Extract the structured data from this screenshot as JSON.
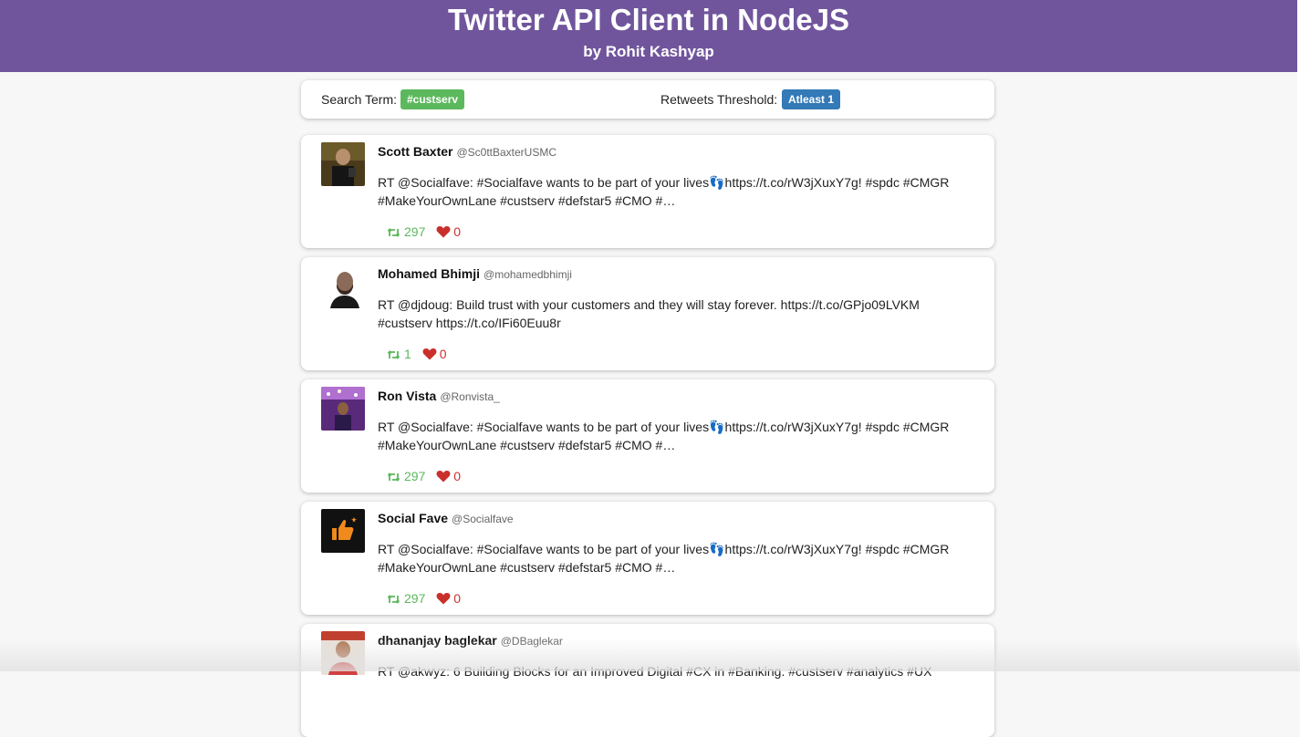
{
  "header": {
    "title": "Twitter API Client in NodeJS",
    "subtitle": "by Rohit Kashyap"
  },
  "filters": {
    "search_label": "Search Term:",
    "search_value": "#custserv",
    "threshold_label": "Retweets Threshold:",
    "threshold_value": "Atleast 1"
  },
  "tweets": [
    {
      "name": "Scott Baxter",
      "handle": "@Sc0ttBaxterUSMC",
      "text": "RT @Socialfave: #Socialfave wants to be part of your lives👣https://t.co/rW3jXuxY7g! #spdc #CMGR #MakeYourOwnLane #custserv #defstar5 #CMO #…",
      "retweets": "297",
      "likes": "0",
      "avatar": "photo-dark"
    },
    {
      "name": "Mohamed Bhimji",
      "handle": "@mohamedbhimji",
      "text": "RT @djdoug: Build trust with your customers and they will stay forever. https://t.co/GPjo09LVKM #custserv https://t.co/IFi60Euu8r",
      "retweets": "1",
      "likes": "0",
      "avatar": "photo-portrait"
    },
    {
      "name": "Ron Vista",
      "handle": "@Ronvista_",
      "text": "RT @Socialfave: #Socialfave wants to be part of your lives👣https://t.co/rW3jXuxY7g! #spdc #CMGR #MakeYourOwnLane #custserv #defstar5 #CMO #…",
      "retweets": "297",
      "likes": "0",
      "avatar": "photo-purple"
    },
    {
      "name": "Social Fave",
      "handle": "@Socialfave",
      "text": "RT @Socialfave: #Socialfave wants to be part of your lives👣https://t.co/rW3jXuxY7g! #spdc #CMGR #MakeYourOwnLane #custserv #defstar5 #CMO #…",
      "retweets": "297",
      "likes": "0",
      "avatar": "thumbs-up-logo"
    },
    {
      "name": "dhananjay baglekar",
      "handle": "@DBaglekar",
      "text": "RT @akwyz: 6 Building Blocks for an Improved Digital #CX in #Banking. #custserv #analytics #UX",
      "retweets": "",
      "likes": "",
      "avatar": "photo-red"
    }
  ],
  "colors": {
    "header_bg": "#70559c",
    "search_badge": "#5cb85c",
    "threshold_badge": "#337ab7",
    "retweet": "#5cb85c",
    "like": "#c9302c"
  }
}
